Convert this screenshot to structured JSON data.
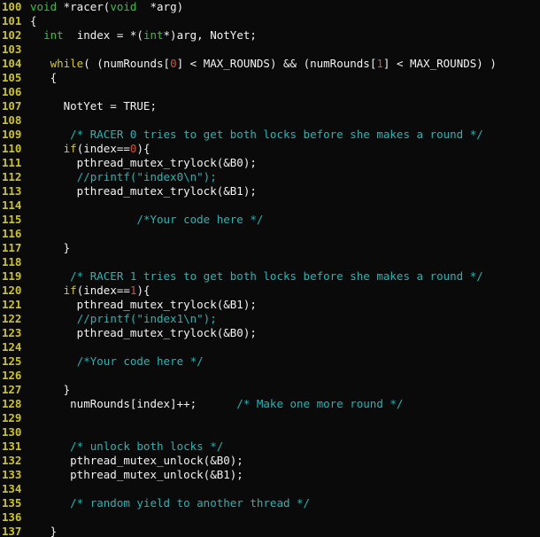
{
  "editor": {
    "language": "C",
    "theme": "dark",
    "background_color": "#0a0a0a",
    "line_number_color": "#ccc427",
    "text_color": "#f2f2f2",
    "comment_color": "#29b4b4",
    "keyword_color": "#d8c82e",
    "type_color": "#2fc63b",
    "number_color": "#d64f3a",
    "first_line_number": 100,
    "last_line_number": 137
  },
  "lines": [
    {
      "n": "100",
      "tokens": [
        {
          "t": "void",
          "c": "type"
        },
        {
          "t": " *racer(",
          "c": "plain"
        },
        {
          "t": "void",
          "c": "type"
        },
        {
          "t": "  *arg)",
          "c": "plain"
        }
      ]
    },
    {
      "n": "101",
      "tokens": [
        {
          "t": "{",
          "c": "plain"
        }
      ]
    },
    {
      "n": "102",
      "tokens": [
        {
          "t": "  ",
          "c": "plain"
        },
        {
          "t": "int",
          "c": "type"
        },
        {
          "t": "  index = *(",
          "c": "plain"
        },
        {
          "t": "int",
          "c": "type"
        },
        {
          "t": "*)arg, NotYet;",
          "c": "plain"
        }
      ]
    },
    {
      "n": "103",
      "tokens": []
    },
    {
      "n": "104",
      "tokens": [
        {
          "t": "   ",
          "c": "plain"
        },
        {
          "t": "while",
          "c": "kw"
        },
        {
          "t": "( (numRounds[",
          "c": "plain"
        },
        {
          "t": "0",
          "c": "num"
        },
        {
          "t": "] < MAX_ROUNDS) && (numRounds[",
          "c": "plain"
        },
        {
          "t": "1",
          "c": "num"
        },
        {
          "t": "] < MAX_ROUNDS) )",
          "c": "plain"
        }
      ]
    },
    {
      "n": "105",
      "tokens": [
        {
          "t": "   {",
          "c": "plain"
        }
      ]
    },
    {
      "n": "106",
      "tokens": []
    },
    {
      "n": "107",
      "tokens": [
        {
          "t": "     NotYet = TRUE;",
          "c": "plain"
        }
      ]
    },
    {
      "n": "108",
      "tokens": []
    },
    {
      "n": "109",
      "tokens": [
        {
          "t": "      ",
          "c": "plain"
        },
        {
          "t": "/* RACER 0 tries to get both locks before she makes a round */",
          "c": "cmt"
        }
      ]
    },
    {
      "n": "110",
      "tokens": [
        {
          "t": "     ",
          "c": "plain"
        },
        {
          "t": "if",
          "c": "kw"
        },
        {
          "t": "(index==",
          "c": "plain"
        },
        {
          "t": "0",
          "c": "num"
        },
        {
          "t": "){",
          "c": "plain"
        }
      ]
    },
    {
      "n": "111",
      "tokens": [
        {
          "t": "       pthread_mutex_trylock(&B0);",
          "c": "plain"
        }
      ]
    },
    {
      "n": "112",
      "tokens": [
        {
          "t": "       ",
          "c": "plain"
        },
        {
          "t": "//printf(\"index0\\n\");",
          "c": "cmt"
        }
      ]
    },
    {
      "n": "113",
      "tokens": [
        {
          "t": "       pthread_mutex_trylock(&B1);",
          "c": "plain"
        }
      ]
    },
    {
      "n": "114",
      "tokens": []
    },
    {
      "n": "115",
      "tokens": [
        {
          "t": "                ",
          "c": "plain"
        },
        {
          "t": "/*Your code here */",
          "c": "cmt"
        }
      ]
    },
    {
      "n": "116",
      "tokens": []
    },
    {
      "n": "117",
      "tokens": [
        {
          "t": "     }",
          "c": "plain"
        }
      ]
    },
    {
      "n": "118",
      "tokens": []
    },
    {
      "n": "119",
      "tokens": [
        {
          "t": "      ",
          "c": "plain"
        },
        {
          "t": "/* RACER 1 tries to get both locks before she makes a round */",
          "c": "cmt"
        }
      ]
    },
    {
      "n": "120",
      "tokens": [
        {
          "t": "     ",
          "c": "plain"
        },
        {
          "t": "if",
          "c": "kw"
        },
        {
          "t": "(index==",
          "c": "plain"
        },
        {
          "t": "1",
          "c": "num"
        },
        {
          "t": "){",
          "c": "plain"
        }
      ]
    },
    {
      "n": "121",
      "tokens": [
        {
          "t": "       pthread_mutex_trylock(&B1);",
          "c": "plain"
        }
      ]
    },
    {
      "n": "122",
      "tokens": [
        {
          "t": "       ",
          "c": "plain"
        },
        {
          "t": "//printf(\"index1\\n\");",
          "c": "cmt"
        }
      ]
    },
    {
      "n": "123",
      "tokens": [
        {
          "t": "       pthread_mutex_trylock(&B0);",
          "c": "plain"
        }
      ]
    },
    {
      "n": "124",
      "tokens": []
    },
    {
      "n": "125",
      "tokens": [
        {
          "t": "       ",
          "c": "plain"
        },
        {
          "t": "/*Your code here */",
          "c": "cmt"
        }
      ]
    },
    {
      "n": "126",
      "tokens": []
    },
    {
      "n": "127",
      "tokens": [
        {
          "t": "     }",
          "c": "plain"
        }
      ]
    },
    {
      "n": "128",
      "tokens": [
        {
          "t": "      numRounds[index]++;      ",
          "c": "plain"
        },
        {
          "t": "/* Make one more round */",
          "c": "cmt"
        }
      ]
    },
    {
      "n": "129",
      "tokens": []
    },
    {
      "n": "130",
      "tokens": []
    },
    {
      "n": "131",
      "tokens": [
        {
          "t": "      ",
          "c": "plain"
        },
        {
          "t": "/* unlock both locks */",
          "c": "cmt"
        }
      ]
    },
    {
      "n": "132",
      "tokens": [
        {
          "t": "      pthread_mutex_unlock(&B0);",
          "c": "plain"
        }
      ]
    },
    {
      "n": "133",
      "tokens": [
        {
          "t": "      pthread_mutex_unlock(&B1);",
          "c": "plain"
        }
      ]
    },
    {
      "n": "134",
      "tokens": []
    },
    {
      "n": "135",
      "tokens": [
        {
          "t": "      ",
          "c": "plain"
        },
        {
          "t": "/* random yield to another thread */",
          "c": "cmt"
        }
      ]
    },
    {
      "n": "136",
      "tokens": []
    },
    {
      "n": "137",
      "tokens": [
        {
          "t": "   }",
          "c": "plain"
        }
      ]
    }
  ]
}
